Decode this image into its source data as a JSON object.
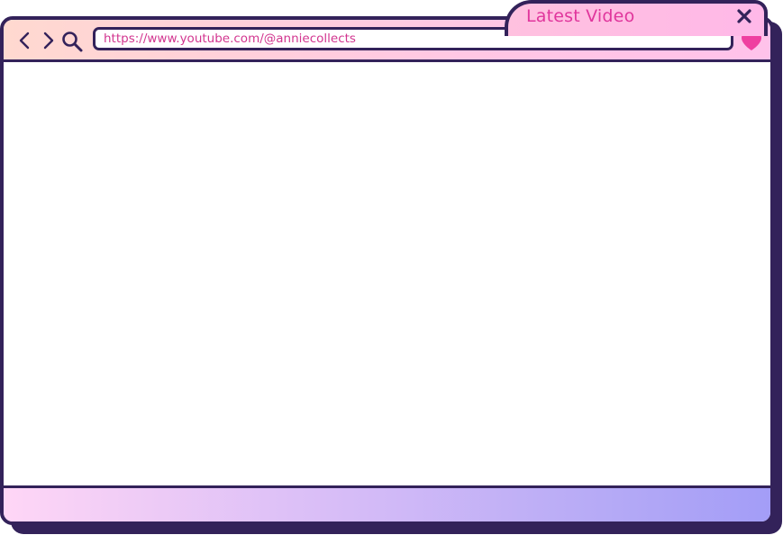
{
  "window": {
    "title": "Latest Video",
    "url": "https://www.youtube.com/@anniecollects"
  },
  "icons": {
    "back": "chevron-left-icon",
    "forward": "chevron-right-icon",
    "search": "search-icon",
    "favorite": "heart-icon",
    "close": "close-icon"
  },
  "colors": {
    "frame": "#33225a",
    "accent_pink": "#e0359c",
    "heart": "#ef3fa0",
    "toolbar_gradient_start": "#ffd9d0",
    "toolbar_gradient_end": "#ffc2ea",
    "footer_gradient_start": "#ffd6f6",
    "footer_gradient_end": "#a39df7"
  }
}
